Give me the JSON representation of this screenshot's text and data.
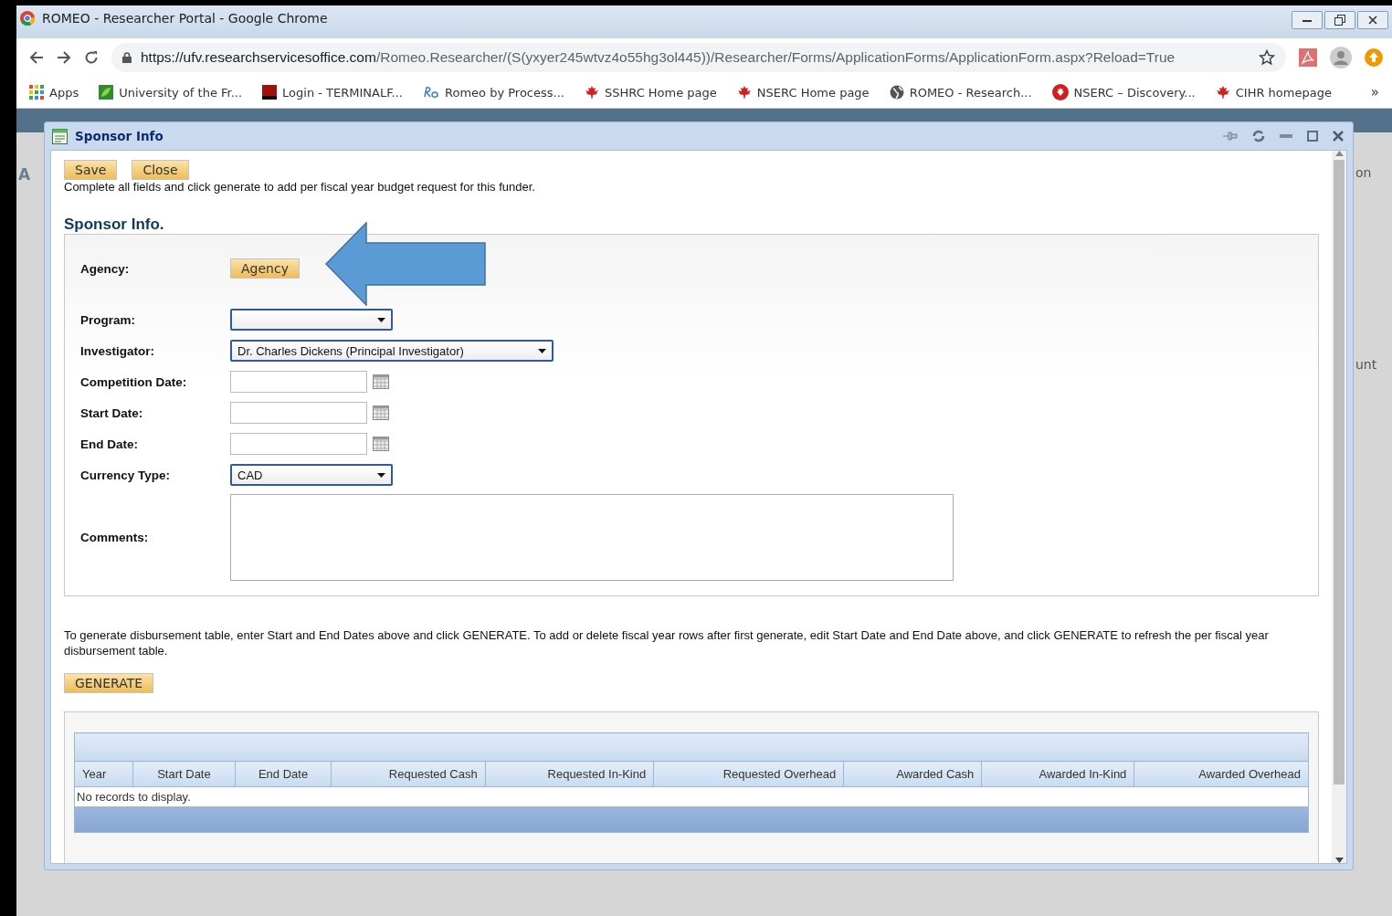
{
  "browser": {
    "title": "ROMEO - Researcher Portal - Google Chrome",
    "url_host": "https://ufv.researchservicesoffice.com",
    "url_path": "/Romeo.Researcher/(S(yxyer245wtvz4o55hg3ol445))/Researcher/Forms/ApplicationForms/ApplicationForm.aspx?Reload=True",
    "bookmarks": [
      {
        "label": "Apps",
        "kind": "apps"
      },
      {
        "label": "University of the Fr...",
        "kind": "leaf"
      },
      {
        "label": "Login - TERMINALF...",
        "kind": "terminal"
      },
      {
        "label": "Romeo by Process...",
        "kind": "romeo"
      },
      {
        "label": "SSHRC Home page",
        "kind": "maple"
      },
      {
        "label": "NSERC Home page",
        "kind": "maple"
      },
      {
        "label": "ROMEO - Research...",
        "kind": "globe"
      },
      {
        "label": "NSERC – Discovery...",
        "kind": "circle"
      },
      {
        "label": "CIHR homepage",
        "kind": "maple"
      }
    ],
    "more": "»"
  },
  "background_page": {
    "left_fragment": "A",
    "right_fragment": "on",
    "column_fragment": "unt"
  },
  "dialog": {
    "title": "Sponsor Info",
    "toolbar_buttons": [
      "Save",
      "Close"
    ],
    "instruction": "Complete all fields and click generate to add per fiscal year budget request for this funder.",
    "section_title": "Sponsor Info.",
    "fields": [
      {
        "label": "Agency:",
        "kind": "button",
        "value": "Agency"
      },
      {
        "label": "Program:",
        "kind": "select"
      },
      {
        "label": "Investigator:",
        "kind": "select",
        "value": "Dr. Charles Dickens (Principal Investigator)"
      },
      {
        "label": "Competition Date:",
        "kind": "date"
      },
      {
        "label": "Start Date:",
        "kind": "date"
      },
      {
        "label": "End Date:",
        "kind": "date"
      },
      {
        "label": "Currency Type:",
        "kind": "select",
        "value": "CAD"
      },
      {
        "label": "Comments:",
        "kind": "textarea"
      }
    ],
    "generate_note": "To generate disbursement table, enter Start and End Dates above and click GENERATE. To add or delete fiscal year rows after first generate, edit Start Date and End Date above, and click GENERATE to refresh the per fiscal year disbursement table.",
    "generate_button": "GENERATE",
    "table": {
      "columns": [
        "Year",
        "Start Date",
        "End Date",
        "Requested Cash",
        "Requested In-Kind",
        "Requested Overhead",
        "Awarded Cash",
        "Awarded In-Kind",
        "Awarded Overhead"
      ],
      "empty_text": "No records to display."
    }
  }
}
